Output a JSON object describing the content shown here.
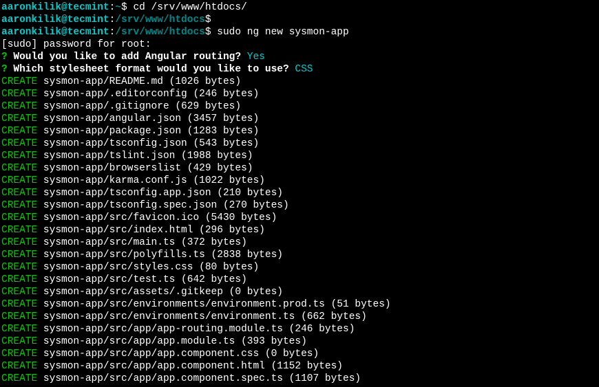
{
  "prompt1_user": "aaronkilik@tecmint",
  "prompt1_dir": "~",
  "prompt1_cmd": "cd /srv/www/htdocs/",
  "prompt2_user": "aaronkilik@tecmint",
  "prompt2_dir": "/srv/www/htdocs",
  "prompt3_user": "aaronkilik@tecmint",
  "prompt3_dir": "/srv/www/htdocs",
  "prompt3_cmd": "sudo ng new sysmon-app",
  "sudo_line": "[sudo] password for root:",
  "q1_mark": "?",
  "q1_text": " Would you like to add Angular routing?",
  "q1_answer": " Yes",
  "q2_mark": "?",
  "q2_text": " Which stylesheet format would you like to use?",
  "q2_answer": " CSS",
  "create_label": "CREATE",
  "files": [
    " sysmon-app/README.md (1026 bytes)",
    " sysmon-app/.editorconfig (246 bytes)",
    " sysmon-app/.gitignore (629 bytes)",
    " sysmon-app/angular.json (3457 bytes)",
    " sysmon-app/package.json (1283 bytes)",
    " sysmon-app/tsconfig.json (543 bytes)",
    " sysmon-app/tslint.json (1988 bytes)",
    " sysmon-app/browserslist (429 bytes)",
    " sysmon-app/karma.conf.js (1022 bytes)",
    " sysmon-app/tsconfig.app.json (210 bytes)",
    " sysmon-app/tsconfig.spec.json (270 bytes)",
    " sysmon-app/src/favicon.ico (5430 bytes)",
    " sysmon-app/src/index.html (296 bytes)",
    " sysmon-app/src/main.ts (372 bytes)",
    " sysmon-app/src/polyfills.ts (2838 bytes)",
    " sysmon-app/src/styles.css (80 bytes)",
    " sysmon-app/src/test.ts (642 bytes)",
    " sysmon-app/src/assets/.gitkeep (0 bytes)",
    " sysmon-app/src/environments/environment.prod.ts (51 bytes)",
    " sysmon-app/src/environments/environment.ts (662 bytes)",
    " sysmon-app/src/app/app-routing.module.ts (246 bytes)",
    " sysmon-app/src/app/app.module.ts (393 bytes)",
    " sysmon-app/src/app/app.component.css (0 bytes)",
    " sysmon-app/src/app/app.component.html (1152 bytes)",
    " sysmon-app/src/app/app.component.spec.ts (1107 bytes)"
  ]
}
